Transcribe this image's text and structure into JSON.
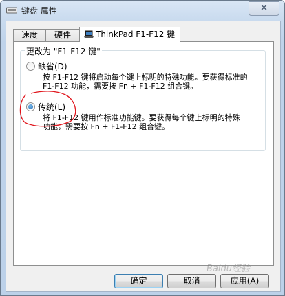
{
  "window": {
    "title": "键盘 属性",
    "close_glyph": "✕"
  },
  "tabs": [
    {
      "label": "速度"
    },
    {
      "label": "硬件"
    },
    {
      "label": "ThinkPad F1-F12 键",
      "active": true
    }
  ],
  "group": {
    "label": "更改为 \"F1-F12 键\"",
    "options": [
      {
        "label": "缺省(D)",
        "checked": false,
        "description_lines": [
          "按 F1-F12 键将启动每个键上标明的特殊功能。要获得标准的",
          "F1-F12 功能，需要按 Fn + F1-F12 组合键。"
        ]
      },
      {
        "label": "传统(L)",
        "checked": true,
        "description_lines": [
          "将 F1-F12 键用作标准功能键。要获得每个键上标明的特殊",
          "功能，需要按 Fn + F1-F12 组合键。"
        ]
      }
    ]
  },
  "buttons": {
    "ok": "确定",
    "cancel": "取消",
    "apply": "应用(A)"
  },
  "watermark": "Baidu经验",
  "colors": {
    "annotation_circle": "#e0141b",
    "radio_checked": "#1f66b0"
  }
}
